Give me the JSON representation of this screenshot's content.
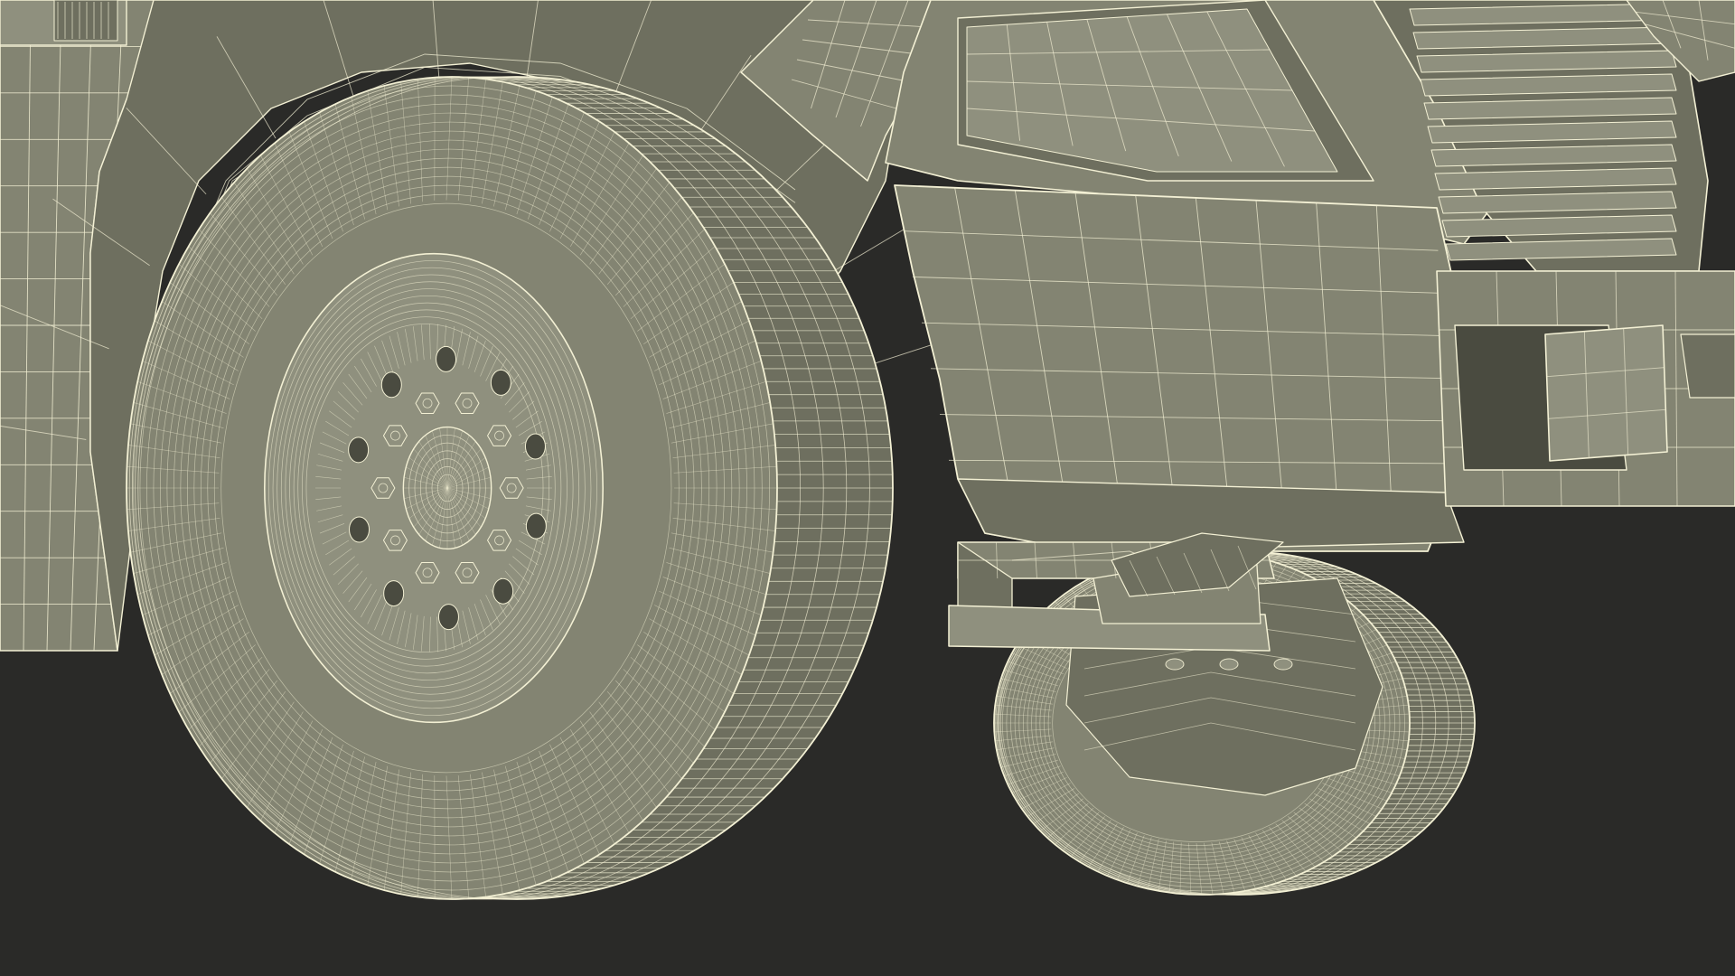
{
  "colors": {
    "background": "#2a2a28",
    "surface": "#838472",
    "surface_dark": "#6e6f5f",
    "surface_light": "#8f907e",
    "shadow": "#4a4b40",
    "wire": "#f3f0d4"
  }
}
